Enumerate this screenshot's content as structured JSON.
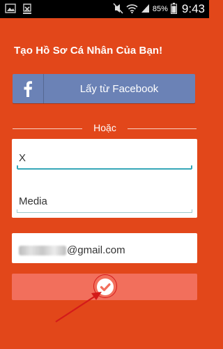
{
  "status_bar": {
    "battery": "85%",
    "time": "9:43",
    "icons": [
      "image-icon",
      "download-icon",
      "mute-icon",
      "wifi-icon",
      "signal-icon",
      "battery-icon"
    ]
  },
  "signup": {
    "title": "Tạo Hồ Sơ Cá Nhân Của Bạn!",
    "facebook_button": "Lấy từ Facebook",
    "facebook_icon_glyph": "f",
    "or_label": "Hoặc",
    "first_name": "X",
    "last_name": "Media",
    "email_visible": "@gmail.com",
    "submit_icon": "check-icon"
  },
  "colors": {
    "background": "#e2471a",
    "facebook": "#6b82b6",
    "submit": "#f26f5c",
    "field_accent": "#36a7b8",
    "annotation": "#d41a1a"
  }
}
